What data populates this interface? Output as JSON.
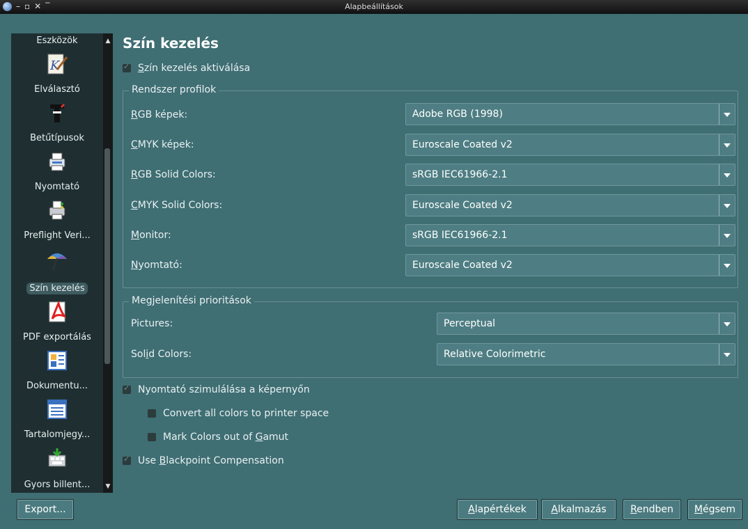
{
  "window": {
    "title": "Alapbeállítások",
    "controls": [
      "–",
      "▫",
      "✕",
      "‾"
    ]
  },
  "sidebar": {
    "items": [
      {
        "label": "Eszközök",
        "icon": "tools-icon"
      },
      {
        "label": "Elválasztó",
        "icon": "hyphenator-icon"
      },
      {
        "label": "Betűtípusok",
        "icon": "fonts-icon"
      },
      {
        "label": "Nyomtató",
        "icon": "printer-icon"
      },
      {
        "label": "Preflight Veri...",
        "icon": "preflight-icon"
      },
      {
        "label": "Szín kezelés",
        "icon": "color-management-icon",
        "selected": true
      },
      {
        "label": "PDF exportálás",
        "icon": "pdf-icon"
      },
      {
        "label": "Dokumentu...",
        "icon": "document-items-icon"
      },
      {
        "label": "Tartalomjegy...",
        "icon": "toc-icon"
      },
      {
        "label": "Gyors billent...",
        "icon": "keyboard-shortcuts-icon"
      }
    ]
  },
  "main": {
    "title": "Szín kezelés",
    "activate": {
      "label_u": "S",
      "label_rest": "zín kezelés aktiválása",
      "checked": true
    },
    "system_profiles": {
      "title": "Rendszer profilok",
      "rows": [
        {
          "label_u": "R",
          "label_rest": "GB képek:",
          "value": "Adobe RGB (1998)"
        },
        {
          "label_u": "C",
          "label_rest": "MYK képek:",
          "value": "Euroscale Coated v2"
        },
        {
          "label_u": "R",
          "label_rest": "GB Solid Colors:",
          "value": "sRGB IEC61966-2.1"
        },
        {
          "label_u": "C",
          "label_rest": "MYK Solid Colors:",
          "value": "Euroscale Coated v2"
        },
        {
          "label_u": "M",
          "label_rest": "onitor:",
          "value": "sRGB IEC61966-2.1"
        },
        {
          "label_u": "N",
          "label_rest": "yomtató:",
          "value": "Euroscale Coated v2"
        }
      ]
    },
    "priorities": {
      "title": "Megjelenítési prioritások",
      "pictures_label": "Pictures:",
      "pictures_value": "Perceptual",
      "solid_label_pre": "Sol",
      "solid_label_u": "i",
      "solid_label_post": "d Colors:",
      "solid_value": "Relative Colorimetric"
    },
    "simulate": {
      "label": "Nyomtató szimulálása a képernyőn",
      "checked": true
    },
    "convert": {
      "label": "Convert all colors to printer space",
      "checked": false
    },
    "gamut": {
      "label_pre": "Mark Colors out of ",
      "label_u": "G",
      "label_post": "amut",
      "checked": false
    },
    "blackpoint": {
      "label_pre": "Use ",
      "label_u": "B",
      "label_post": "lackpoint Compensation",
      "checked": true
    }
  },
  "buttons": {
    "export": "Export...",
    "defaults_u": "A",
    "defaults_rest": "lapértékek",
    "apply_u": "A",
    "apply_rest": "lkalmazás",
    "ok_u": "R",
    "ok_rest": "endben",
    "cancel_u": "M",
    "cancel_rest": "égsem"
  }
}
